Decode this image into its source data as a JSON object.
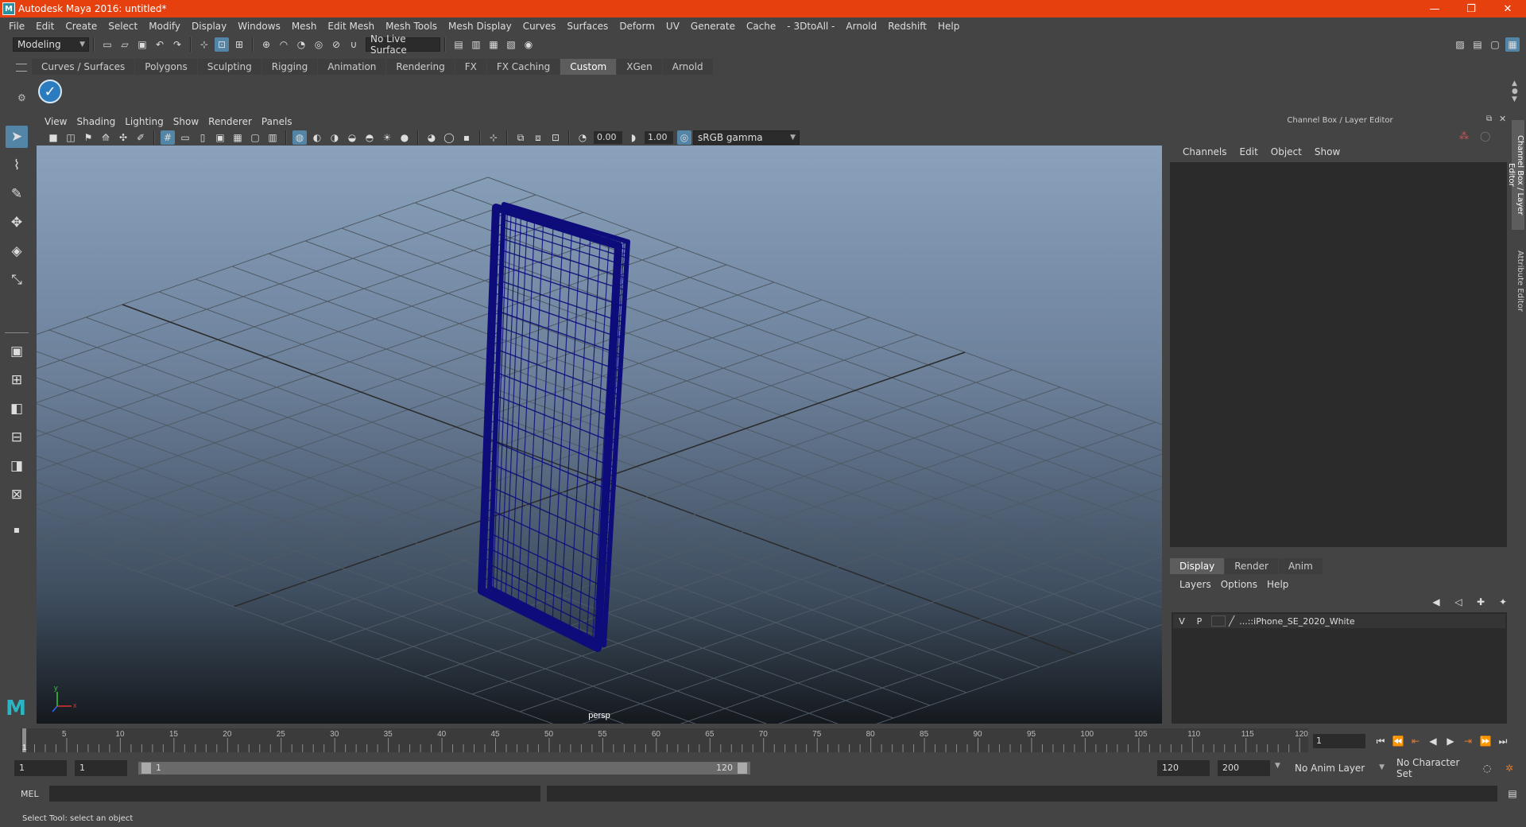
{
  "window": {
    "title": "Autodesk Maya 2016: untitled*",
    "logo_letter": "M",
    "minimize": "—",
    "restore": "❐",
    "close": "✕"
  },
  "menubar": [
    "File",
    "Edit",
    "Create",
    "Select",
    "Modify",
    "Display",
    "Windows",
    "Mesh",
    "Edit Mesh",
    "Mesh Tools",
    "Mesh Display",
    "Curves",
    "Surfaces",
    "Deform",
    "UV",
    "Generate",
    "Cache",
    "- 3DtoAll -",
    "Arnold",
    "Redshift",
    "Help"
  ],
  "statusline": {
    "menuset": "Modeling",
    "live_surface": "No Live Surface"
  },
  "shelf": {
    "tabs": [
      "Curves / Surfaces",
      "Polygons",
      "Sculpting",
      "Rigging",
      "Animation",
      "Rendering",
      "FX",
      "FX Caching",
      "Custom",
      "XGen",
      "Arnold"
    ],
    "active_tab": "Custom",
    "button_glyph": "✓"
  },
  "viewport": {
    "menu": [
      "View",
      "Shading",
      "Lighting",
      "Show",
      "Renderer",
      "Panels"
    ],
    "exposure": "0.00",
    "gamma": "1.00",
    "color_space": "sRGB gamma",
    "camera_label": "persp",
    "axis_x": "x",
    "axis_y": "y"
  },
  "channel_box": {
    "header": "Channel Box / Layer Editor",
    "menu": [
      "Channels",
      "Edit",
      "Object",
      "Show"
    ],
    "side_tabs": [
      "Channel Box / Layer Editor",
      "Attribute Editor"
    ]
  },
  "layer_editor": {
    "tabs": [
      "Display",
      "Render",
      "Anim"
    ],
    "active_tab": "Display",
    "menu": [
      "Layers",
      "Options",
      "Help"
    ],
    "layers": [
      {
        "v": "V",
        "p": "P",
        "name": "...::iPhone_SE_2020_White"
      }
    ]
  },
  "timeline": {
    "ticks": [
      5,
      10,
      15,
      20,
      25,
      30,
      35,
      40,
      45,
      50,
      55,
      60,
      65,
      70,
      75,
      80,
      85,
      90,
      95,
      100,
      105,
      110,
      115,
      120
    ],
    "start_tick": "1",
    "current_frame": "1"
  },
  "range": {
    "start": "1",
    "current": "1",
    "slider_start": "1",
    "slider_end": "120",
    "end": "120",
    "max": "200",
    "anim_layer": "No Anim Layer",
    "character_set": "No Character Set"
  },
  "command_line": {
    "label": "MEL"
  },
  "help_line": "Select Tool: select an object"
}
